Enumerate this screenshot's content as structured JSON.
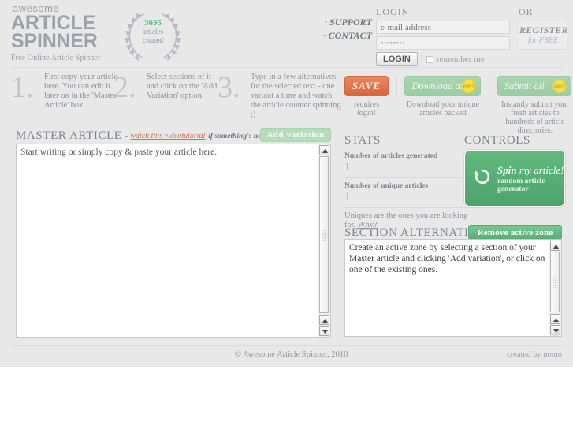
{
  "brand": {
    "awesome": "awesome",
    "line1": "ARTICLE",
    "line2": "SPINNER",
    "tagline": "Free Online Article Spinner"
  },
  "wreath": {
    "count": "3695",
    "label_line1": "articles",
    "label_line2": "created"
  },
  "nav": {
    "support": "· SUPPORT",
    "contact": "· CONTACT"
  },
  "login": {
    "caption": "LOGIN",
    "email_placeholder": "e-mail address",
    "email_value": "",
    "password_value": "••••••••",
    "button": "LOGIN",
    "remember_label": "remember me"
  },
  "register": {
    "caption": "OR",
    "line1": "REGISTER",
    "line2": "for FREE"
  },
  "steps": [
    {
      "num": "1.",
      "text": "First copy your article here. You can edit it later on in the 'Master Article' box."
    },
    {
      "num": "2.",
      "text": "Select sections of it and click on the 'Add Variation' option."
    },
    {
      "num": "3.",
      "text": "Type in a few alternatives for the selected text - one variant a time and watch the article counter spinning ;)"
    }
  ],
  "actions": {
    "save": {
      "label": "SAVE",
      "sub": "requires login!"
    },
    "download": {
      "label": "Download all",
      "badge": "PRO",
      "sub": "Download your unique articles packed"
    },
    "submit": {
      "label": "Submit all",
      "badge": "PRO",
      "sub": "Instantly submit your fresh articles to hundreds of article directories."
    }
  },
  "master": {
    "title": "MASTER ARTICLE",
    "dash": "-",
    "tutorial_link": "watch this videotutorial",
    "tutorial_note": "if something's not clear ;)",
    "add_variation": "Add variation",
    "textarea_placeholder": "Start writing or simply copy & paste your article here."
  },
  "stats": {
    "title": "STATS",
    "generated_label": "Number of articles generated",
    "generated_value": "1",
    "unique_label": "Number of unique articles",
    "unique_value": "1",
    "note_a": "Uniques are the ones you are looking for. ",
    "note_b": "Why?"
  },
  "controls": {
    "title": "CONTROLS",
    "spin_icon": "refresh-icon",
    "spin_strong": "Spin",
    "spin_rest": " my article!",
    "spin_sub": "random article generator"
  },
  "alternatives": {
    "title": "SECTION ALTERNATIVES",
    "remove_button": "Remove active zone",
    "placeholder": "Create an active zone by selecting a section of your Master article and clicking 'Add variation', or click on one of the existing ones."
  },
  "footer": {
    "copyright": "© Awesome Article Spinner, 2010",
    "credit": "created by nomo"
  },
  "colors": {
    "accent_green": "#5db87a",
    "accent_orange": "#d9653a",
    "text_gray": "#8d949c",
    "page_bg": "#e8e8e8"
  }
}
